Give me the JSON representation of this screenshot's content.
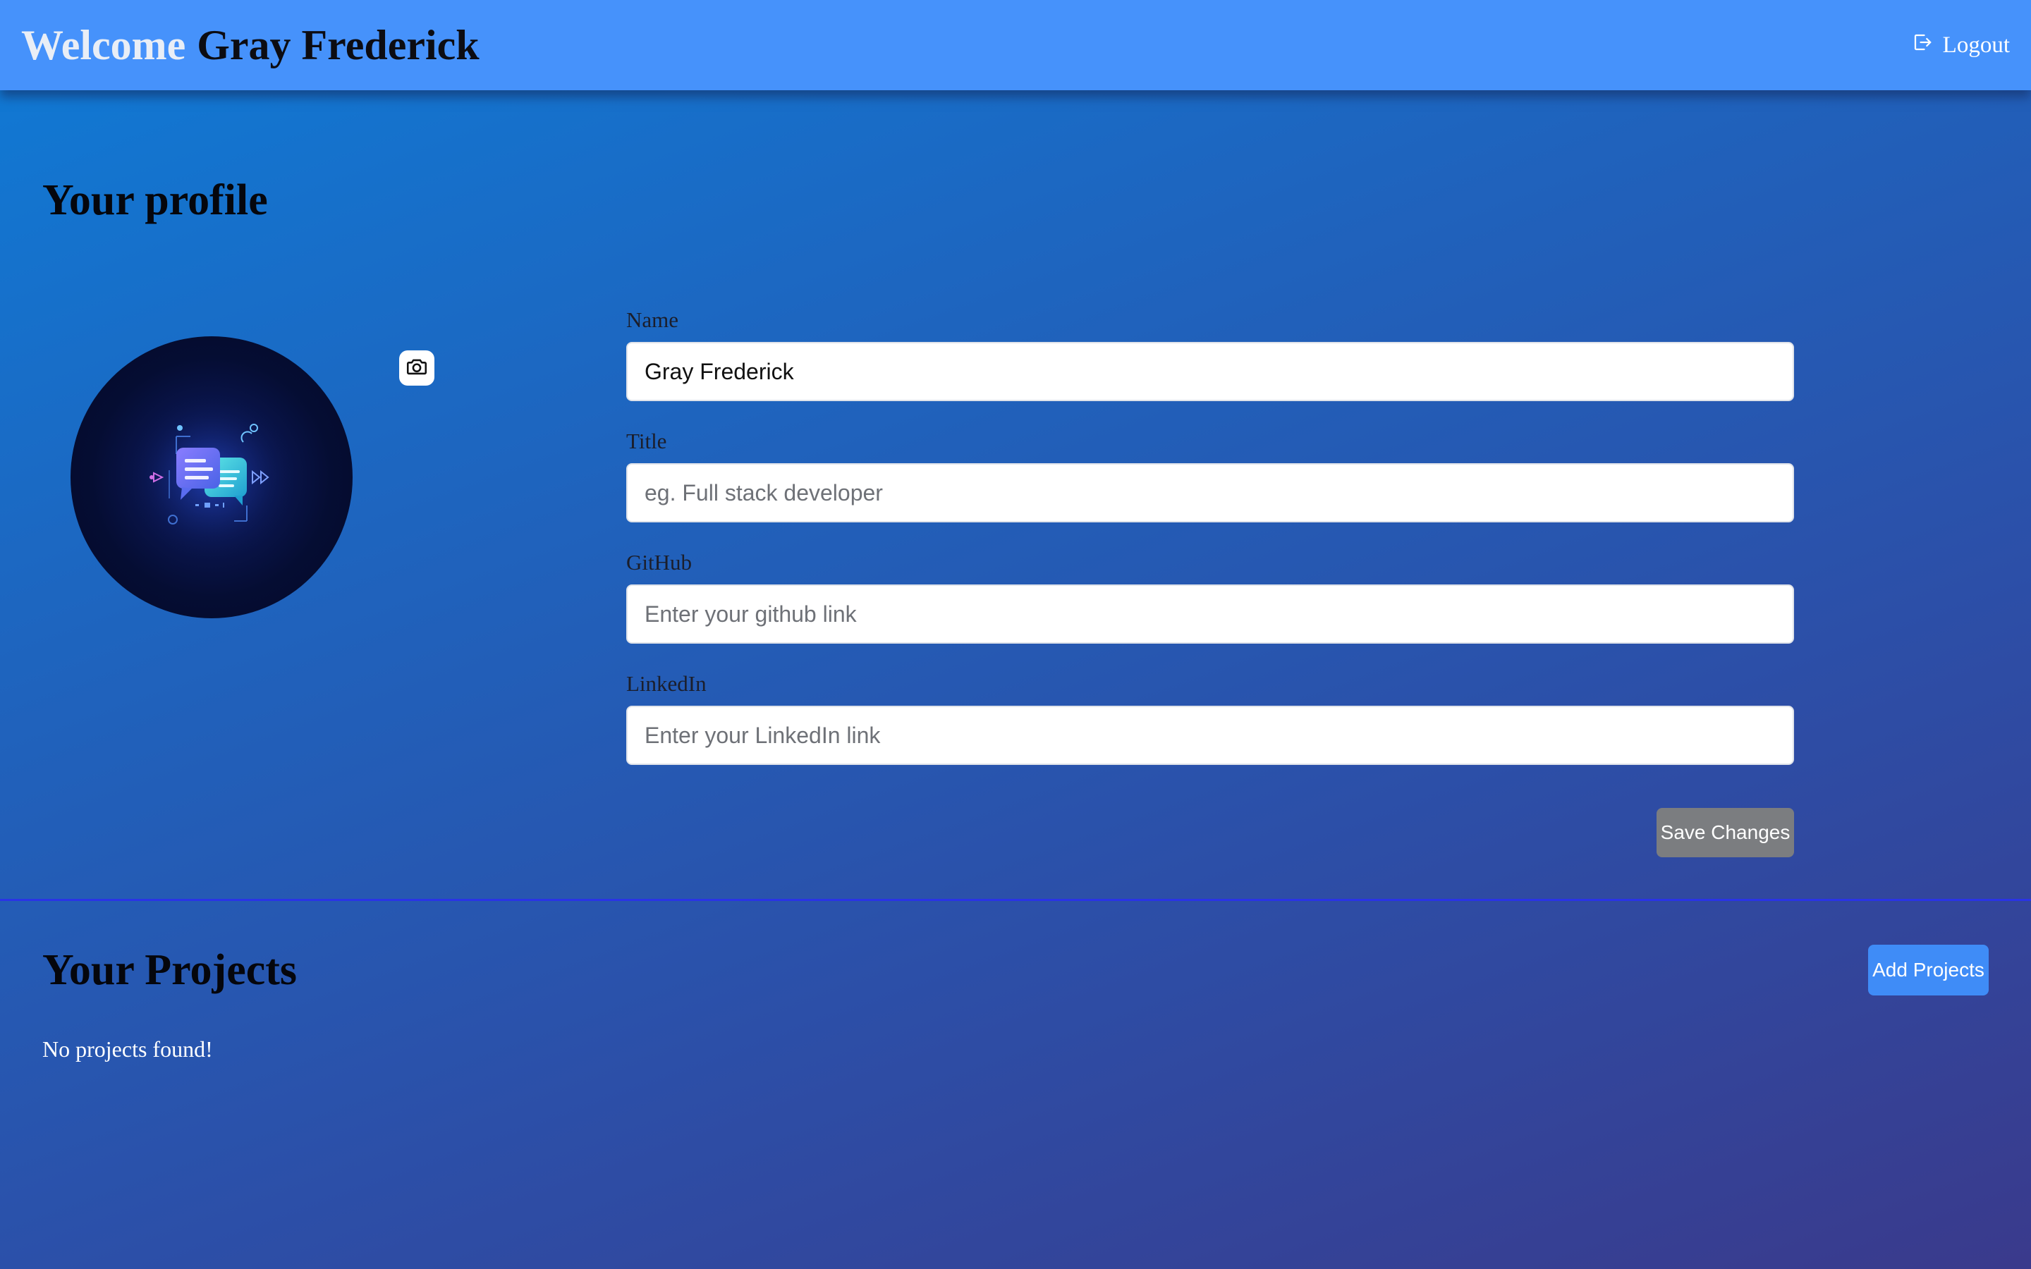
{
  "header": {
    "greeting": "Welcome",
    "user_name": "Gray Frederick",
    "logout_label": "Logout",
    "logout_icon": "logout-icon",
    "bg_color": "#4692fb"
  },
  "profile": {
    "title": "Your profile",
    "avatar_icon": "chat-bubbles-illustration",
    "camera_icon": "camera-icon",
    "fields": [
      {
        "label": "Name",
        "value": "Gray Frederick",
        "placeholder": ""
      },
      {
        "label": "Title",
        "value": "",
        "placeholder": "eg. Full stack developer"
      },
      {
        "label": "GitHub",
        "value": "",
        "placeholder": "Enter your github link"
      },
      {
        "label": "LinkedIn",
        "value": "",
        "placeholder": "Enter your LinkedIn link"
      }
    ],
    "save_label": "Save Changes",
    "save_color": "#7b7d80"
  },
  "projects": {
    "title": "Your Projects",
    "add_label": "Add Projects",
    "add_color": "#3f8cf7",
    "empty_message": "No projects found!"
  }
}
